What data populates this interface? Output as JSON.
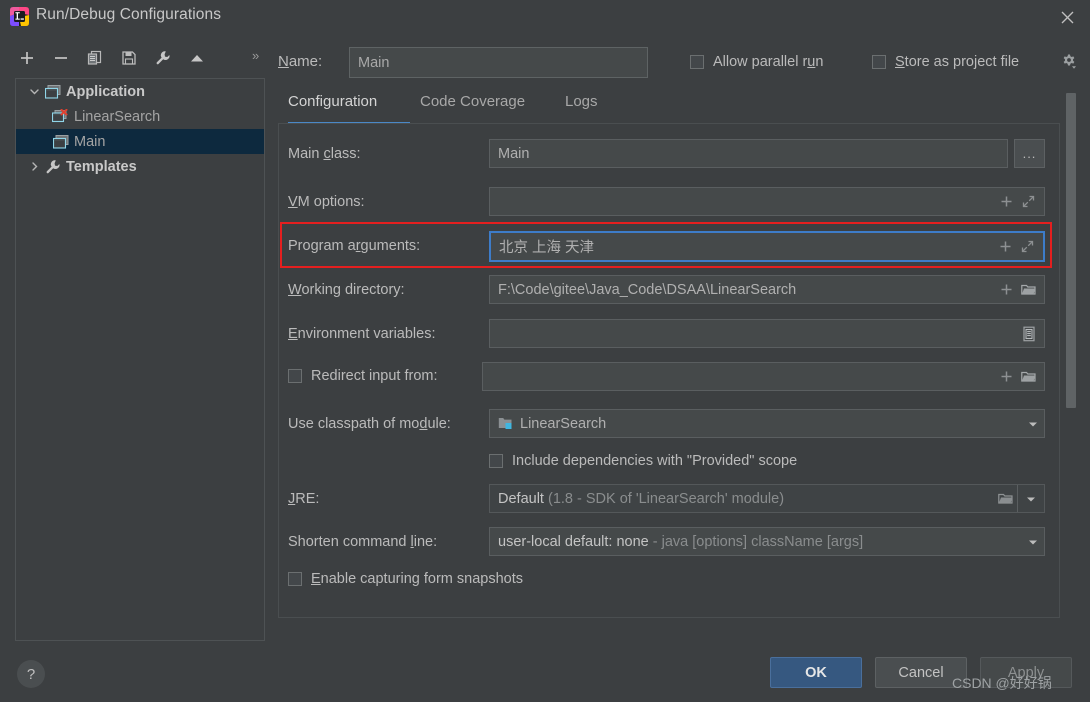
{
  "window": {
    "title": "Run/Debug Configurations",
    "app_icon": "intellij-idea-icon",
    "close_label": "✕"
  },
  "toolbar": {
    "buttons": [
      {
        "name": "add",
        "icon": "plus-icon",
        "label": "+"
      },
      {
        "name": "remove",
        "icon": "minus-icon",
        "label": "−"
      },
      {
        "name": "copy",
        "icon": "copy-icon",
        "label": "Copy Configuration"
      },
      {
        "name": "save",
        "icon": "save-icon",
        "label": "Save Configuration"
      },
      {
        "name": "edit-templates",
        "icon": "wrench-icon",
        "label": "Edit Templates"
      },
      {
        "name": "move-up",
        "icon": "arrow-up-icon",
        "label": "Move Up"
      }
    ],
    "overflow_label": "»"
  },
  "tree": {
    "items": [
      {
        "label": "Application",
        "icon": "application-icon",
        "expanded": true,
        "bold": true,
        "indent": 0,
        "selected": false,
        "error": false
      },
      {
        "label": "LinearSearch",
        "icon": "application-icon",
        "expanded": null,
        "bold": false,
        "indent": 1,
        "selected": false,
        "error": true
      },
      {
        "label": "Main",
        "icon": "application-icon",
        "expanded": null,
        "bold": false,
        "indent": 1,
        "selected": true,
        "error": false
      },
      {
        "label": "Templates",
        "icon": "wrench-icon",
        "expanded": false,
        "bold": true,
        "indent": 0,
        "selected": false,
        "error": false
      }
    ]
  },
  "header": {
    "name_label": "Name:",
    "name_label_accel": "N",
    "name_value": "Main",
    "allow_parallel_run": {
      "label": "Allow parallel run",
      "accel": "u",
      "checked": false
    },
    "store_as_project_file": {
      "label": "Store as project file",
      "accel": "S",
      "checked": false
    },
    "gear_icon": "gear-icon"
  },
  "tabs": {
    "items": [
      {
        "label": "Configuration",
        "active": true
      },
      {
        "label": "Code Coverage",
        "active": false
      },
      {
        "label": "Logs",
        "active": false
      }
    ],
    "accent_color": "#4a88c7"
  },
  "form": {
    "main_class": {
      "label": "Main class:",
      "accel": "c",
      "value": "Main",
      "browse_label": "..."
    },
    "vm_options": {
      "label": "VM options:",
      "accel": "V",
      "value": "",
      "icons": [
        "plus-icon",
        "expand-icon"
      ]
    },
    "program_arguments": {
      "label": "Program arguments:",
      "accel": "r",
      "value": "北京 上海 天津",
      "focused": true,
      "icons": [
        "plus-icon",
        "expand-icon"
      ],
      "highlight_color": "#e51f1f"
    },
    "working_directory": {
      "label": "Working directory:",
      "accel": "W",
      "value": "F:\\Code\\gitee\\Java_Code\\DSAA\\LinearSearch",
      "icons": [
        "plus-icon",
        "folder-icon"
      ]
    },
    "environment_variables": {
      "label": "Environment variables:",
      "accel": "E",
      "value": "",
      "icons": [
        "list-icon"
      ]
    },
    "redirect_input_from": {
      "label": "Redirect input from:",
      "checked": false,
      "value": "",
      "icons": [
        "plus-icon",
        "folder-icon"
      ]
    },
    "use_classpath_of_module": {
      "label": "Use classpath of module:",
      "accel": "d",
      "value": "LinearSearch",
      "icon": "module-icon"
    },
    "include_provided_scope": {
      "label": "Include dependencies with \"Provided\" scope",
      "checked": false
    },
    "jre": {
      "label": "JRE:",
      "accel": "J",
      "value": "Default",
      "value_hint": "(1.8 - SDK of 'LinearSearch' module)",
      "icons": [
        "folder-icon"
      ]
    },
    "shorten_command_line": {
      "label": "Shorten command line:",
      "accel": "l",
      "value": "user-local default: none",
      "value_hint": "- java [options] className [args]"
    },
    "enable_capturing_form_snapshots": {
      "label": "Enable capturing form snapshots",
      "accel": "E",
      "checked": false
    }
  },
  "footer": {
    "help_label": "?",
    "ok_label": "OK",
    "cancel_label": "Cancel",
    "apply_label": "Apply"
  },
  "watermark": "CSDN @好好锅"
}
